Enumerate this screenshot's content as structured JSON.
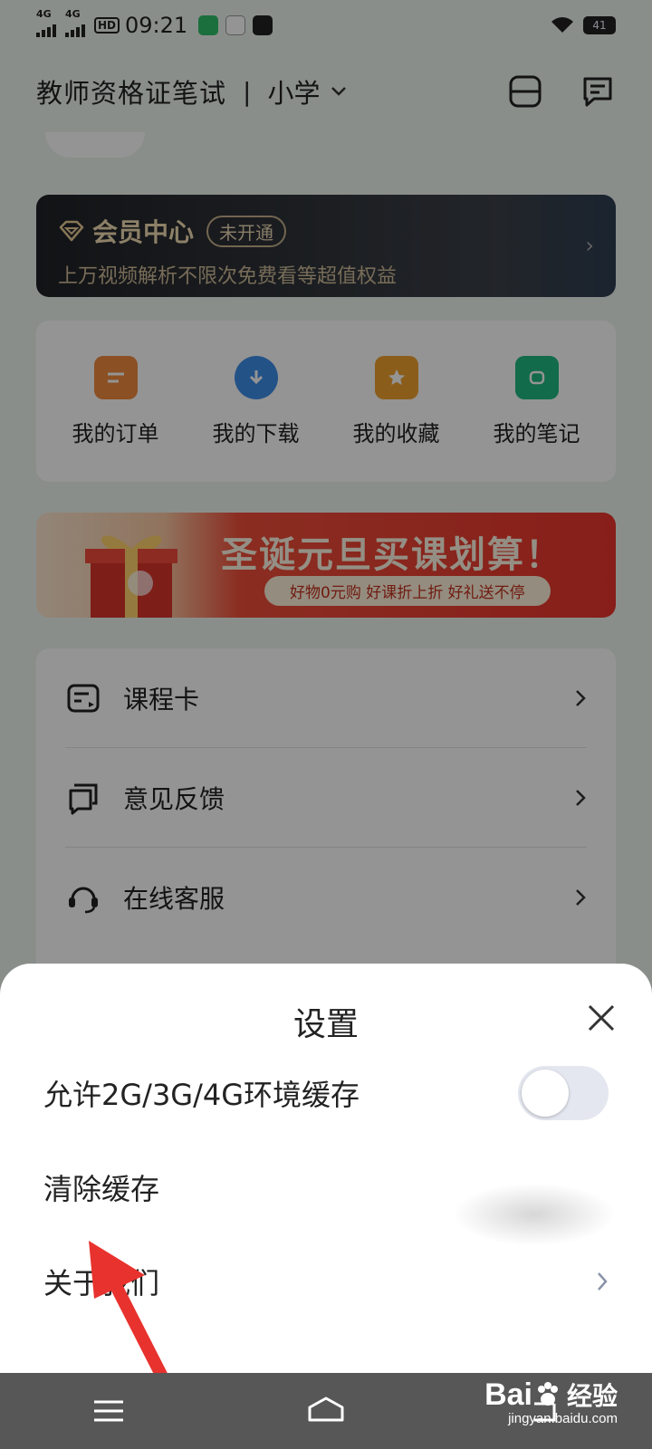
{
  "status_bar": {
    "signal1_label": "4G",
    "signal2_label": "4G",
    "hd_label": "HD",
    "time": "09:21",
    "battery": "41"
  },
  "header": {
    "title": "教师资格证笔试",
    "separator": "|",
    "subject": "小学"
  },
  "vip": {
    "title": "会员中心",
    "badge": "未开通",
    "description": "上万视频解析不限次免费看等超值权益"
  },
  "quick_actions": [
    {
      "label": "我的订单",
      "icon": "order-icon",
      "color": "#f08a3e"
    },
    {
      "label": "我的下载",
      "icon": "download-icon",
      "color": "#3d8ee8"
    },
    {
      "label": "我的收藏",
      "icon": "favorite-icon",
      "color": "#f0a030"
    },
    {
      "label": "我的笔记",
      "icon": "notes-icon",
      "color": "#1fb880"
    }
  ],
  "banner": {
    "title": "圣诞元旦买课划算！",
    "subtitle": "好物0元购  好课折上折  好礼送不停"
  },
  "menu": [
    {
      "label": "课程卡",
      "icon": "course-card-icon"
    },
    {
      "label": "意见反馈",
      "icon": "feedback-icon"
    },
    {
      "label": "在线客服",
      "icon": "headset-icon"
    }
  ],
  "settings_sheet": {
    "title": "设置",
    "rows": [
      {
        "label": "允许2G/3G/4G环境缓存",
        "control": "toggle",
        "enabled": false
      },
      {
        "label": "清除缓存",
        "control": "none"
      },
      {
        "label": "关于我们",
        "control": "chevron"
      }
    ]
  },
  "watermark": {
    "brand_prefix": "Bai",
    "brand_suffix": "经验",
    "url": "jingyan.baidu.com"
  },
  "colors": {
    "toggle_off": "#e4e7ef",
    "nav_bar": "#575757",
    "pointer_arrow": "#e8322e"
  }
}
